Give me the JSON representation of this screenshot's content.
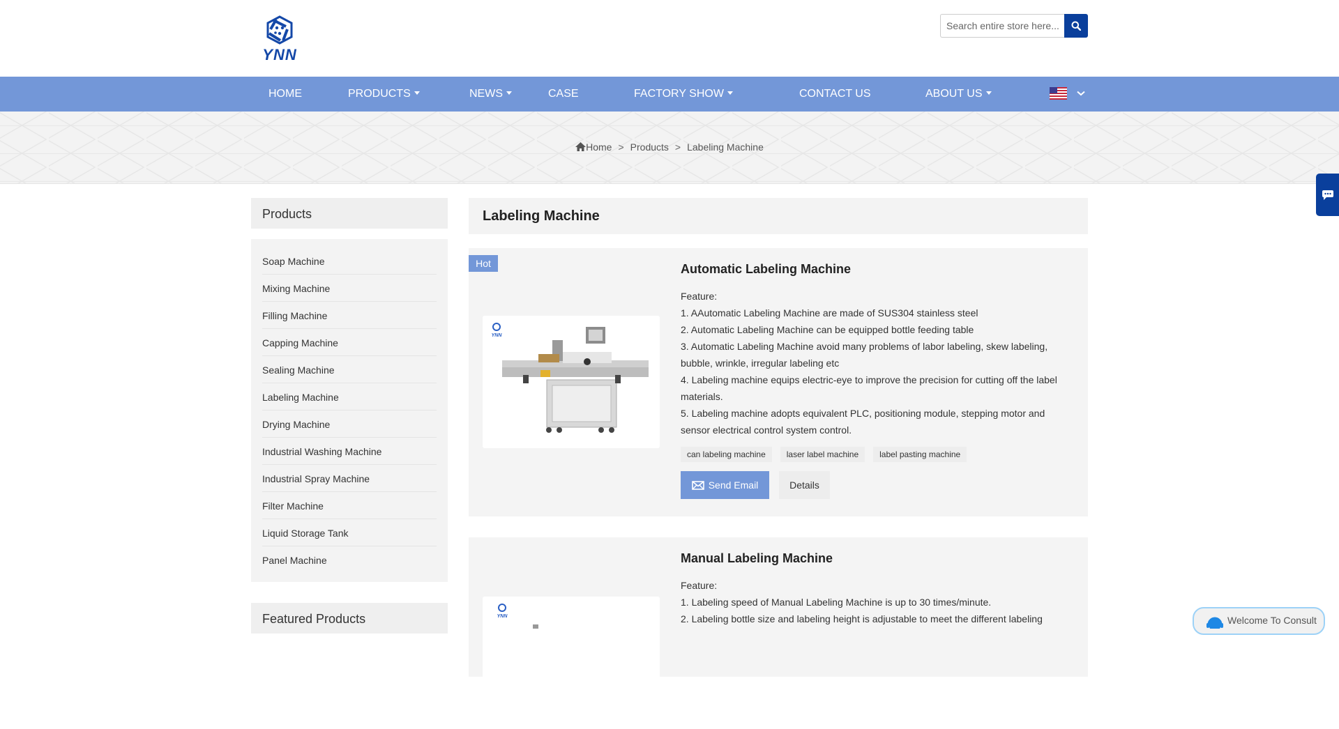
{
  "header": {
    "logo_alt": "YNN",
    "search": {
      "placeholder": "Search entire store here...",
      "value": ""
    }
  },
  "nav": {
    "items": [
      {
        "label": "HOME",
        "dropdown": false
      },
      {
        "label": "PRODUCTS",
        "dropdown": true
      },
      {
        "label": "NEWS",
        "dropdown": true
      },
      {
        "label": "CASE",
        "dropdown": false
      },
      {
        "label": "FACTORY SHOW",
        "dropdown": true
      },
      {
        "label": "CONTACT US",
        "dropdown": false
      },
      {
        "label": "ABOUT US",
        "dropdown": true
      }
    ],
    "language": "en-US"
  },
  "breadcrumb": {
    "items": [
      "Home",
      "Products",
      "Labeling Machine"
    ],
    "separator": ">"
  },
  "sidebar": {
    "title": "Products",
    "items": [
      "Soap Machine",
      "Mixing Machine",
      "Filling Machine",
      "Capping Machine",
      "Sealing Machine",
      "Labeling Machine",
      "Drying Machine",
      "Industrial Washing Machine",
      "Industrial Spray Machine",
      "Filter Machine",
      "Liquid Storage Tank",
      "Panel Machine"
    ],
    "featured_title": "Featured Products"
  },
  "main": {
    "title": "Labeling Machine",
    "products": [
      {
        "badge": "Hot",
        "title": "Automatic Labeling Machine",
        "feature_label": "Feature:",
        "features": [
          "1. AAutomatic Labeling Machine are made of SUS304 stainless steel",
          "2. Automatic Labeling Machine can be equipped bottle feeding table",
          "3. Automatic Labeling Machine avoid many problems of labor labeling, skew labeling, bubble, wrinkle, irregular labeling etc",
          "4. Labeling machine equips electric-eye to improve the precision for cutting off the label materials.",
          "5. Labeling machine adopts equivalent PLC, positioning module, stepping motor and sensor electrical control system control."
        ],
        "tags": [
          "can labeling machine",
          "laser label machine",
          "label pasting machine"
        ],
        "send_email_label": "Send Email",
        "details_label": "Details"
      },
      {
        "title": "Manual Labeling Machine",
        "feature_label": "Feature:",
        "features": [
          "1. Labeling speed of Manual Labeling Machine is up to 30 times/minute.",
          "2. Labeling bottle size and labeling height is adjustable to meet the different labeling"
        ]
      }
    ]
  },
  "widgets": {
    "consult_label": "Welcome To Consult"
  },
  "colors": {
    "nav_bg": "#7397d8",
    "brand_dark": "#0a3f9c",
    "panel_bg": "#f3f3f3"
  }
}
